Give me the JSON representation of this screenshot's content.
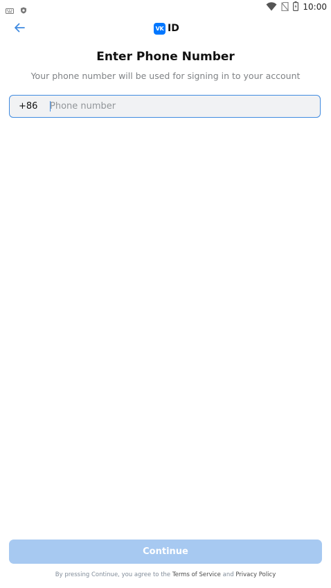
{
  "status_bar": {
    "time": "10:00",
    "left_icons": [
      "keyboard-icon",
      "shield-icon"
    ],
    "right_icons": [
      "wifi-icon",
      "no-sim-icon",
      "battery-icon"
    ]
  },
  "header": {
    "brand_logo_text": "VK",
    "brand_text": "ID",
    "back_icon": "arrow-left-icon"
  },
  "main": {
    "title": "Enter Phone Number",
    "subtitle": "Your phone number will be used for signing in to your account",
    "phone_field": {
      "country_code": "+86",
      "value": "",
      "placeholder": "Phone number"
    }
  },
  "footer": {
    "continue_label": "Continue",
    "legal_prefix": "By pressing Continue, you agree to the ",
    "terms_label": "Terms of Service",
    "and_text": " and ",
    "privacy_label": "Privacy Policy"
  },
  "colors": {
    "accent": "#3f8ae0",
    "brand": "#0077ff",
    "button_disabled": "#a7c9f1",
    "field_bg": "#f1f2f4"
  }
}
